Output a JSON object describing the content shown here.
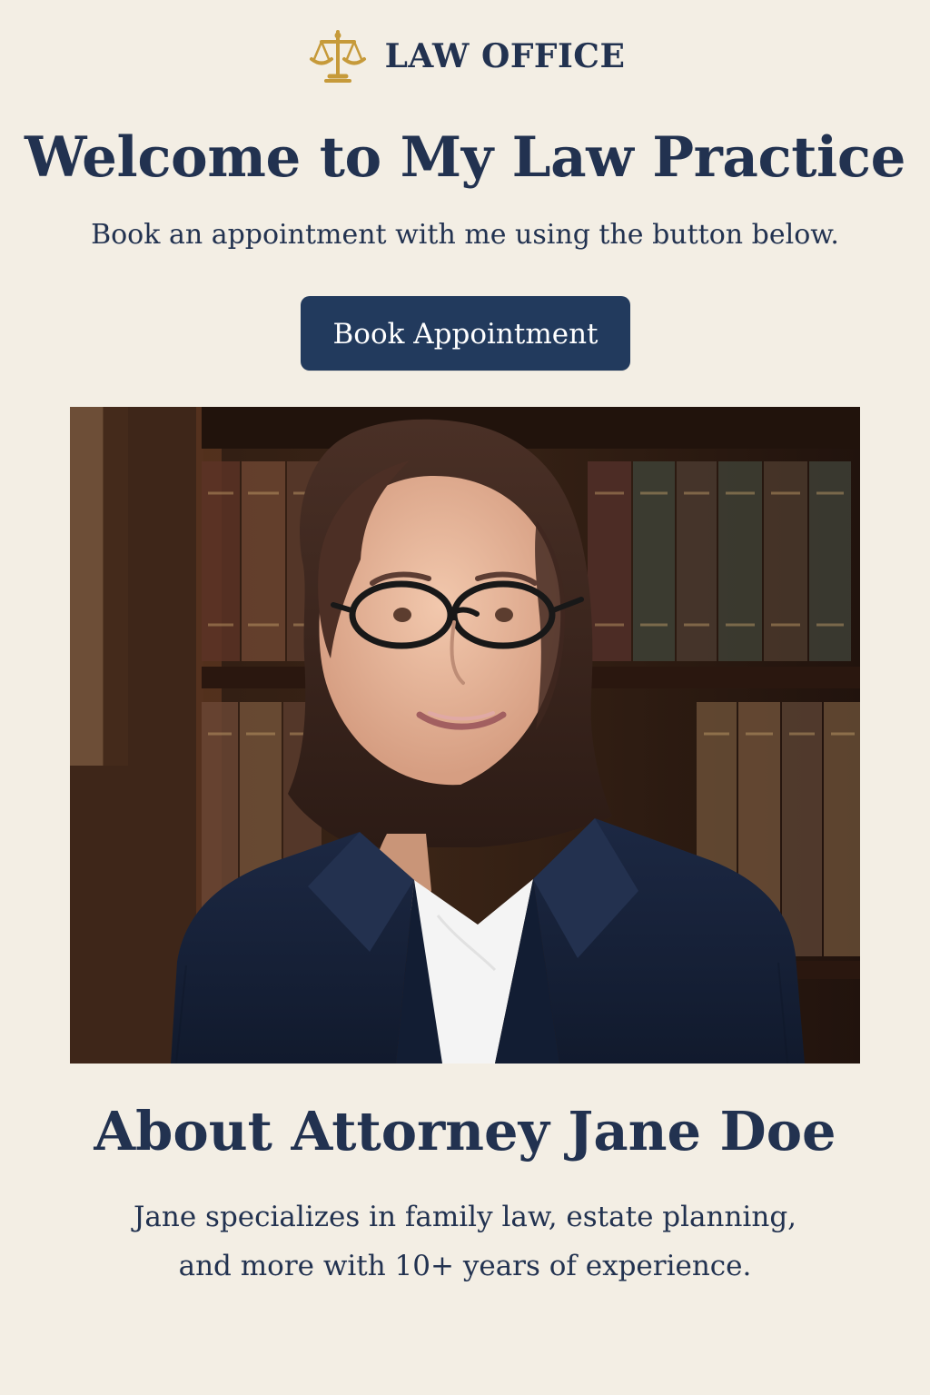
{
  "header": {
    "brand_name": "LAW OFFICE",
    "logo_icon": "scales-of-justice-icon",
    "accent_color": "#c69a3a"
  },
  "hero": {
    "title": "Welcome to My Law Practice",
    "subtitle": "Book an appointment with me using the button below.",
    "button_label": "Book Appointment",
    "button_color": "#223a5d"
  },
  "photo": {
    "subject": "attorney-portrait"
  },
  "about": {
    "title": "About Attorney Jane Doe",
    "lines": [
      "Jane specializes in family law, estate planning,",
      "and more with 10+ years of experience."
    ]
  },
  "colors": {
    "background": "#f3eee4",
    "text": "#223250"
  }
}
